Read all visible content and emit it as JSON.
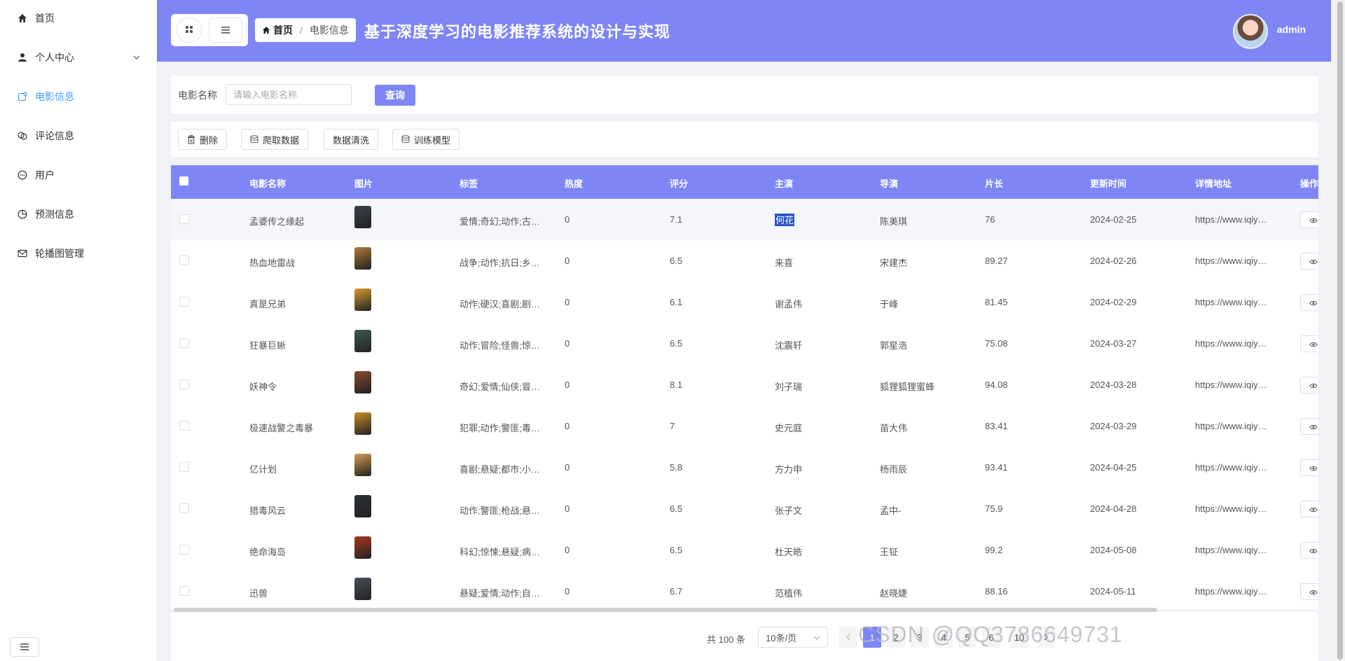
{
  "sidebar": {
    "items": [
      {
        "label": "首页",
        "icon": "home-icon"
      },
      {
        "label": "个人中心",
        "icon": "user-icon"
      },
      {
        "label": "电影信息",
        "icon": "film-icon"
      },
      {
        "label": "评论信息",
        "icon": "comment-icon"
      },
      {
        "label": "用户",
        "icon": "chat-icon"
      },
      {
        "label": "预测信息",
        "icon": "pie-icon"
      },
      {
        "label": "轮播图管理",
        "icon": "mail-icon"
      }
    ],
    "active_index": 2
  },
  "header": {
    "breadcrumb": {
      "home": "首页",
      "separator": "/",
      "current": "电影信息"
    },
    "title": "基于深度学习的电影推荐系统的设计与实现",
    "user": "admin"
  },
  "search": {
    "label": "电影名称",
    "placeholder": "请输入电影名称",
    "button": "查询"
  },
  "toolbar": {
    "delete": "删除",
    "crawl": "爬取数据",
    "clean": "数据清洗",
    "train": "训练模型"
  },
  "table": {
    "columns": [
      "电影名称",
      "图片",
      "标签",
      "热度",
      "评分",
      "主演",
      "导演",
      "片长",
      "更新时间",
      "详情地址",
      "操作"
    ],
    "rows": [
      {
        "name": "孟婆传之缘起",
        "tags": "爱情;奇幻;动作;古…",
        "heat": "0",
        "score": "7.1",
        "actor": "何花",
        "director": "陈美琪",
        "length": "76",
        "updated": "2024-02-25",
        "url": "https://www.iqiy…",
        "thumb": "#3a3f4a"
      },
      {
        "name": "热血地雷战",
        "tags": "战争;动作;抗日;乡…",
        "heat": "0",
        "score": "6.5",
        "actor": "来喜",
        "director": "宋建杰",
        "length": "89.27",
        "updated": "2024-02-26",
        "url": "https://www.iqiy…",
        "thumb": "#b0793a"
      },
      {
        "name": "真是兄弟",
        "tags": "动作;硬汉;喜剧;剧…",
        "heat": "0",
        "score": "6.1",
        "actor": "谢孟伟",
        "director": "于峰",
        "length": "81.45",
        "updated": "2024-02-29",
        "url": "https://www.iqiy…",
        "thumb": "#d59a2e"
      },
      {
        "name": "狂暴巨蜥",
        "tags": "动作;冒险;怪兽;惊…",
        "heat": "0",
        "score": "6.5",
        "actor": "沈震轩",
        "director": "郭星浩",
        "length": "75.08",
        "updated": "2024-03-27",
        "url": "https://www.iqiy…",
        "thumb": "#3b5a4d"
      },
      {
        "name": "妖神令",
        "tags": "奇幻;爱情;仙侠;冒…",
        "heat": "0",
        "score": "8.1",
        "actor": "刘子瑞",
        "director": "狐狸狐狸蜜蜂",
        "length": "94.08",
        "updated": "2024-03-28",
        "url": "https://www.iqiy…",
        "thumb": "#8a4b2f"
      },
      {
        "name": "极速战警之毒暴",
        "tags": "犯罪;动作;警匪;毒…",
        "heat": "0",
        "score": "7",
        "actor": "史元庭",
        "director": "苗大伟",
        "length": "83.41",
        "updated": "2024-03-29",
        "url": "https://www.iqiy…",
        "thumb": "#c98b26"
      },
      {
        "name": "亿计划",
        "tags": "喜剧;悬疑;都市;小…",
        "heat": "0",
        "score": "5.8",
        "actor": "方力申",
        "director": "杨雨辰",
        "length": "93.41",
        "updated": "2024-04-25",
        "url": "https://www.iqiy…",
        "thumb": "#d49a52"
      },
      {
        "name": "猎毒风云",
        "tags": "动作;警匪;枪战;悬…",
        "heat": "0",
        "score": "6.5",
        "actor": "张子文",
        "director": "孟中-",
        "length": "75.9",
        "updated": "2024-04-28",
        "url": "https://www.iqiy…",
        "thumb": "#2c3036"
      },
      {
        "name": "绝命海岛",
        "tags": "科幻;惊悚;悬疑;病…",
        "heat": "0",
        "score": "6.5",
        "actor": "杜天皓",
        "director": "王钲",
        "length": "99.2",
        "updated": "2024-05-08",
        "url": "https://www.iqiy…",
        "thumb": "#a8381f"
      },
      {
        "name": "迅兽",
        "tags": "悬疑;爱情;动作;自…",
        "heat": "0",
        "score": "6.7",
        "actor": "范植伟",
        "director": "赵晓婕",
        "length": "88.16",
        "updated": "2024-05-11",
        "url": "https://www.iqiy…",
        "thumb": "#4a4f5c"
      }
    ]
  },
  "pagination": {
    "total": "共 100 条",
    "page_size": "10条/页",
    "pages": [
      "1",
      "2",
      "3",
      "4",
      "5",
      "6",
      "10"
    ],
    "current": "1"
  },
  "watermark": "CSDN @QQ3786649731",
  "colors": {
    "accent": "#7e86f6",
    "active_nav": "#409eff"
  }
}
